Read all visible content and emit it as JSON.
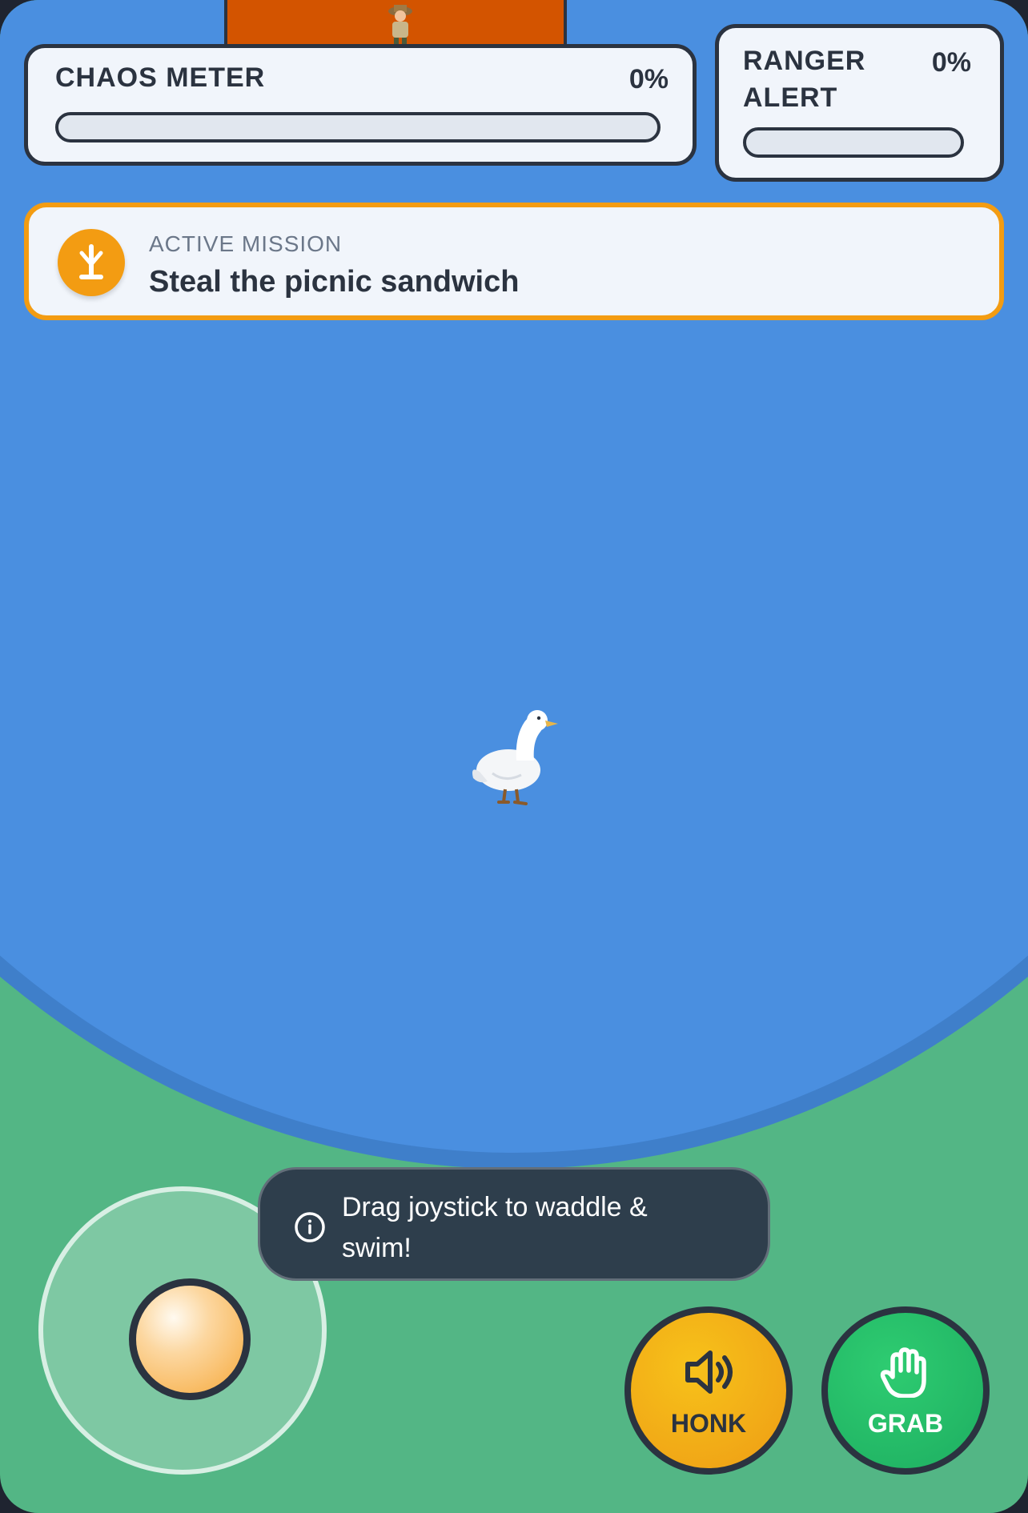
{
  "hud": {
    "chaos": {
      "title": "CHAOS METER",
      "percent_label": "0%",
      "value": 0
    },
    "ranger": {
      "title": "RANGER ALERT",
      "percent_label": "0%",
      "value": 0
    }
  },
  "mission": {
    "label": "ACTIVE MISSION",
    "text": "Steal the picnic sandwich",
    "icon": "broom-icon"
  },
  "tip": {
    "icon": "info-icon",
    "text": "Drag joystick to waddle & swim!"
  },
  "controls": {
    "honk_label": "HONK",
    "honk_icon": "speaker-icon",
    "grab_label": "GRAB",
    "grab_icon": "hand-icon"
  },
  "colors": {
    "water": "#4a8fe0",
    "grass": "#53b685",
    "honk": "#f0a416",
    "grab": "#21b464",
    "mission_accent": "#f39c12"
  }
}
